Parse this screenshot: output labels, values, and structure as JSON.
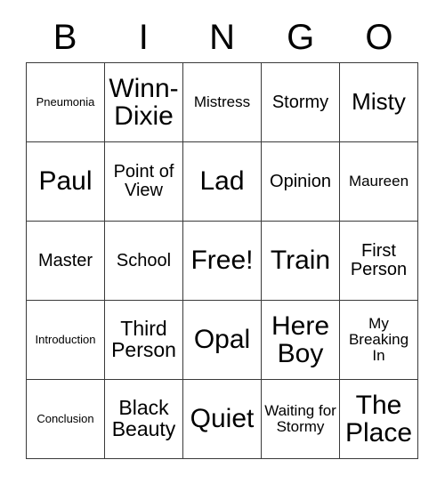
{
  "header": {
    "letters": [
      "B",
      "I",
      "N",
      "G",
      "O"
    ]
  },
  "grid": {
    "columns": 5,
    "rows": 5,
    "border_color": "#3a3a3a",
    "background": "#ffffff",
    "text_color": "#000000",
    "cells": [
      {
        "text": "Pneumonia",
        "size": "xs"
      },
      {
        "text": "Winn-Dixie",
        "size": "xxl"
      },
      {
        "text": "Mistress",
        "size": "s"
      },
      {
        "text": "Stormy",
        "size": "m"
      },
      {
        "text": "Misty",
        "size": "xl"
      },
      {
        "text": "Paul",
        "size": "xxl"
      },
      {
        "text": "Point of View",
        "size": "m"
      },
      {
        "text": "Lad",
        "size": "xxl"
      },
      {
        "text": "Opinion",
        "size": "m"
      },
      {
        "text": "Maureen",
        "size": "s"
      },
      {
        "text": "Master",
        "size": "m"
      },
      {
        "text": "School",
        "size": "m"
      },
      {
        "text": "Free!",
        "size": "xxl"
      },
      {
        "text": "Train",
        "size": "xxl"
      },
      {
        "text": "First Person",
        "size": "m"
      },
      {
        "text": "Introduction",
        "size": "xs"
      },
      {
        "text": "Third Person",
        "size": "l"
      },
      {
        "text": "Opal",
        "size": "xxl"
      },
      {
        "text": "Here Boy",
        "size": "xxl"
      },
      {
        "text": "My Breaking In",
        "size": "s"
      },
      {
        "text": "Conclusion",
        "size": "xs"
      },
      {
        "text": "Black Beauty",
        "size": "l"
      },
      {
        "text": "Quiet",
        "size": "xxl"
      },
      {
        "text": "Waiting for Stormy",
        "size": "s"
      },
      {
        "text": "The Place",
        "size": "xxl"
      }
    ]
  }
}
